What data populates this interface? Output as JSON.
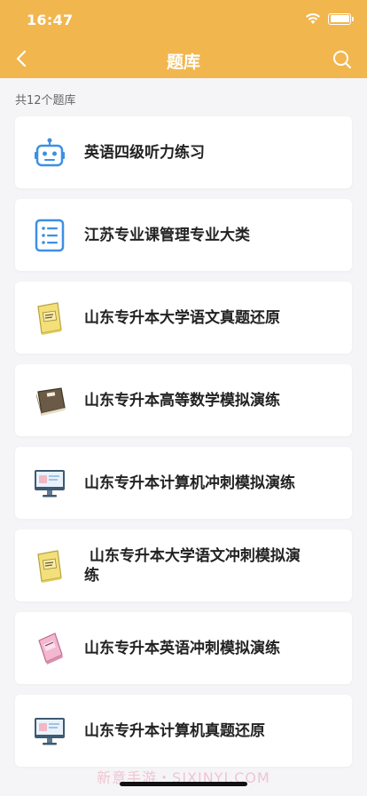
{
  "status_bar": {
    "time": "16:47"
  },
  "nav": {
    "title": "题库"
  },
  "summary": {
    "count_text": "共12个题库"
  },
  "items": [
    {
      "label": "英语四级听力练习",
      "icon": "robot-icon"
    },
    {
      "label": "江苏专业课管理专业大类",
      "icon": "list-document-icon"
    },
    {
      "label": "山东专升本大学语文真题还原",
      "icon": "yellow-book-icon"
    },
    {
      "label": "山东专升本高等数学模拟演练",
      "icon": "brown-book-icon"
    },
    {
      "label": "山东专升本计算机冲刺模拟演练",
      "icon": "computer-monitor-icon"
    },
    {
      "label": " 山东专升本大学语文冲刺模拟演练",
      "icon": "yellow-book-icon"
    },
    {
      "label": "山东专升本英语冲刺模拟演练",
      "icon": "pink-book-icon"
    },
    {
      "label": "山东专升本计算机真题还原",
      "icon": "computer-monitor-icon"
    }
  ],
  "watermark": "新意手游・SIXINYI.COM",
  "colors": {
    "header": "#f2b64e",
    "background": "#f5f5f7",
    "icon_blue": "#3d8fe6"
  }
}
